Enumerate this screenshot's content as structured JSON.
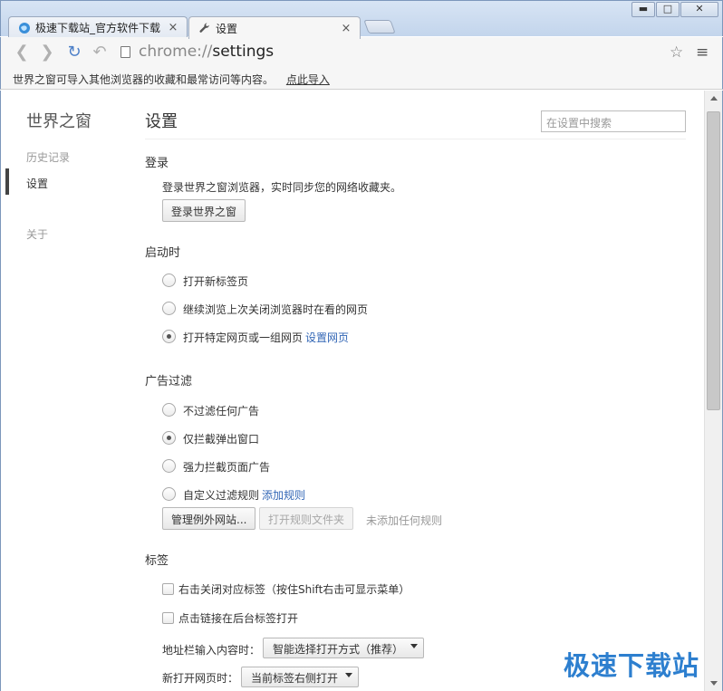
{
  "tabs": [
    {
      "title": "极速下载站_官方软件下载",
      "close": "×",
      "favicon": "globe-icon"
    },
    {
      "title": "设置",
      "close": "×",
      "favicon": "wrench-icon"
    }
  ],
  "window_controls": {
    "minimize": "▬",
    "maximize": "□",
    "close": "✕"
  },
  "toolbar": {
    "url_scheme": "chrome://",
    "url_path": "settings",
    "back_icon": "❮",
    "forward_icon": "❯",
    "reload_icon": "↻",
    "undo_icon": "↶",
    "bookmark_icon": "☆",
    "menu_icon": "≡"
  },
  "infobar": {
    "message": "世界之窗可导入其他浏览器的收藏和最常访问等内容。",
    "link": "点此导入"
  },
  "sidebar": {
    "title": "世界之窗",
    "items": [
      {
        "label": "历史记录"
      },
      {
        "label": "设置",
        "selected": true
      },
      {
        "label": "关于"
      }
    ]
  },
  "page": {
    "title": "设置",
    "search_placeholder": "在设置中搜索"
  },
  "login": {
    "title": "登录",
    "description": "登录世界之窗浏览器，实时同步您的网络收藏夹。",
    "button": "登录世界之窗"
  },
  "startup": {
    "title": "启动时",
    "options": [
      {
        "label": "打开新标签页",
        "checked": false
      },
      {
        "label": "继续浏览上次关闭浏览器时在看的网页",
        "checked": false
      },
      {
        "label": "打开特定网页或一组网页",
        "checked": true,
        "link": "设置网页"
      }
    ]
  },
  "adblock": {
    "title": "广告过滤",
    "options": [
      {
        "label": "不过滤任何广告",
        "checked": false
      },
      {
        "label": "仅拦截弹出窗口",
        "checked": true
      },
      {
        "label": "强力拦截页面广告",
        "checked": false
      },
      {
        "label": "自定义过滤规则",
        "checked": false,
        "link": "添加规则"
      }
    ],
    "manage_button": "管理例外网站...",
    "open_rules_button": "打开规则文件夹",
    "no_rules_text": "未添加任何规则"
  },
  "tabs_section": {
    "title": "标签",
    "checkboxes": [
      {
        "label": "右击关闭对应标签（按住Shift右击可显示菜单）",
        "checked": false
      },
      {
        "label": "点击链接在后台标签打开",
        "checked": false
      }
    ],
    "address_input_label": "地址栏输入内容时：",
    "address_input_value": "智能选择打开方式（推荐）",
    "new_page_label": "新打开网页时：",
    "new_page_value": "当前标签右侧打开"
  },
  "watermark": "极速下载站"
}
